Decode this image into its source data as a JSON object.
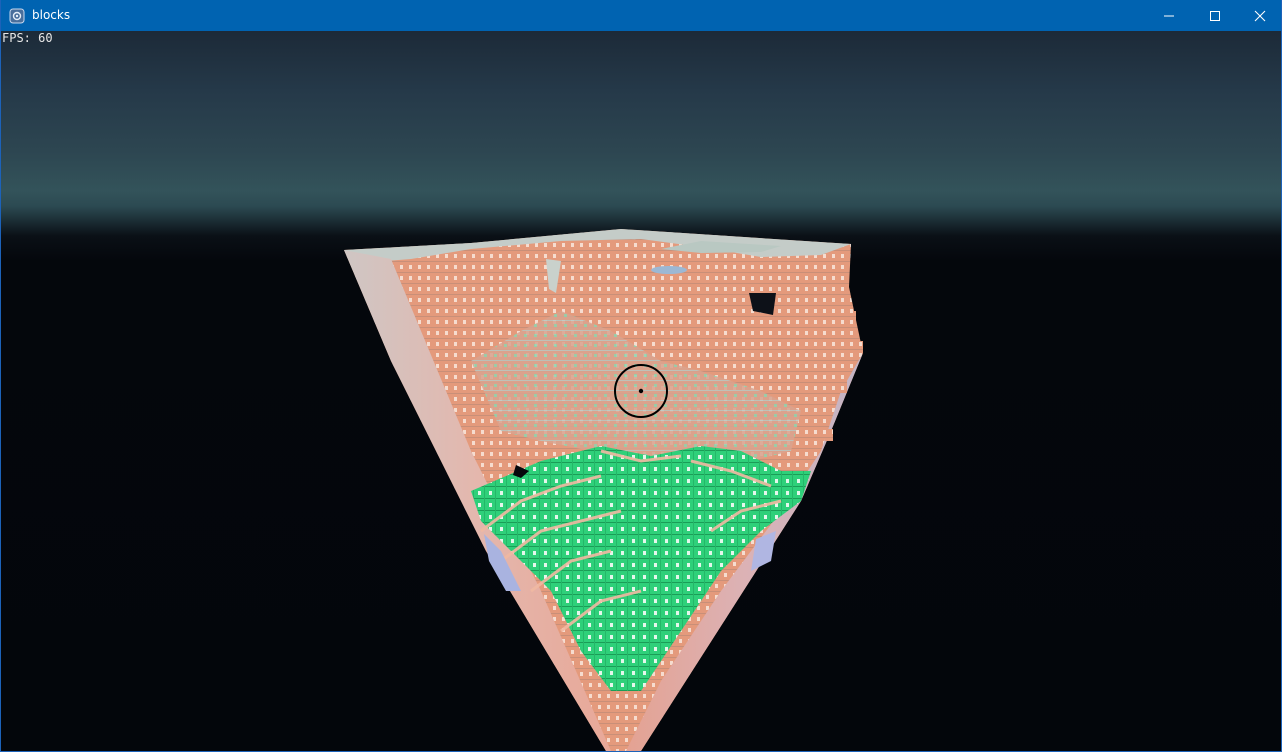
{
  "window": {
    "title": "blocks",
    "icon": "app-icon"
  },
  "hud": {
    "fps_text": "FPS: 60"
  },
  "controls": {
    "minimize": "minimize-icon",
    "maximize": "maximize-icon",
    "close": "close-icon"
  },
  "colors": {
    "titlebar": "#0063b1",
    "sky_top": "#1c2a38",
    "sky_horizon": "#33535a",
    "ground": "#03060b",
    "block_salmon": "#e79a7c",
    "block_green": "#2fd37a",
    "block_pale": "#b9c8c2"
  }
}
